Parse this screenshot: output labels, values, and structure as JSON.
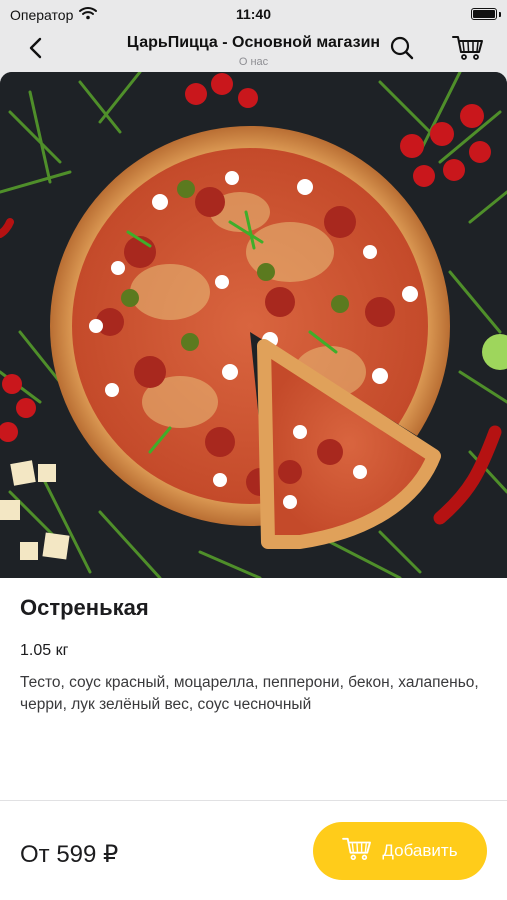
{
  "status_bar": {
    "carrier": "Оператор",
    "time": "11:40",
    "icons": [
      "wifi-icon",
      "battery-icon"
    ]
  },
  "nav": {
    "title": "ЦарьПицца - Основной магазин",
    "subtitle": "О нас",
    "icons": [
      "chevron-left-icon",
      "search-icon",
      "cart-icon"
    ]
  },
  "product": {
    "name": "Остренькая",
    "weight": "1.05 кг",
    "description": "Тесто, соус красный, моцарелла, пепперони, бекон, халапеньо, черри, лук зелёный вес, соус чесночный",
    "price": "От 599 ₽"
  },
  "add_button": {
    "label": "Добавить",
    "icon": "cart-icon"
  },
  "colors": {
    "accent": "#ffcc1a",
    "nav_background": "#e9e9ea",
    "text": "#1c1c1e",
    "secondary_text": "#8e8e93"
  }
}
